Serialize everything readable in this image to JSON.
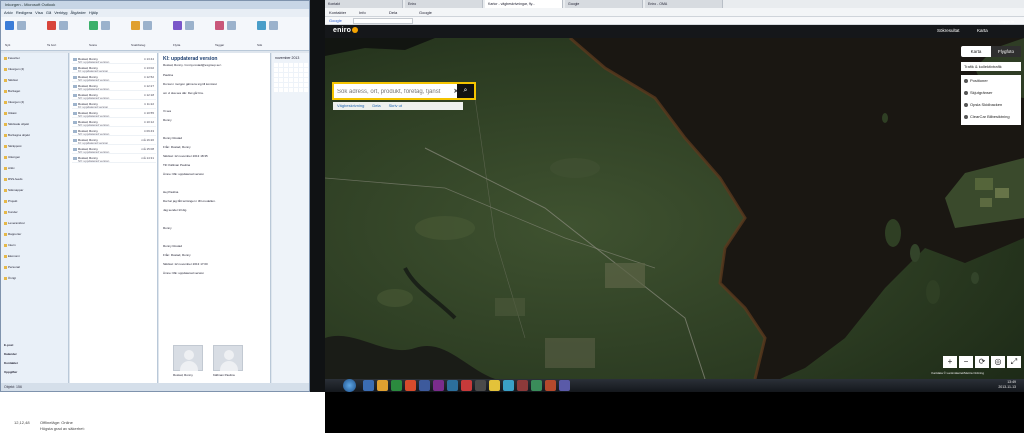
{
  "outlook": {
    "title": "Inkorgen - Microsoft Outlook",
    "menu": [
      "Arkiv",
      "Redigera",
      "Visa",
      "Gå",
      "Verktyg",
      "Åtgärder",
      "Hjälp"
    ],
    "ribbon_groups": [
      "Nytt",
      "Ta bort",
      "Svara",
      "Snabbsteg",
      "Flytta",
      "Taggar",
      "Sök"
    ],
    "folders": [
      "Favoriter",
      "Inkorgen (4)",
      "Skickat",
      "Borttaget",
      "Inkorgen (4)",
      "Utkast",
      "Skickade objekt",
      "Borttagna objekt",
      "Skräppost",
      "Utkorgen",
      "Arkiv",
      "RSS-feeds",
      "Sökmappar",
      "Projekt",
      "Kunder",
      "Leverantörer",
      "Rapporter",
      "Intern",
      "Ekonomi",
      "Personal",
      "Övrigt"
    ],
    "nav_buttons": [
      "E-post",
      "Kalender",
      "Kontakter",
      "Uppgifter"
    ],
    "message_list": [
      {
        "from": "Rostad, Ronny",
        "subject": "SV: uppdaterad version",
        "date": "ti 13:44"
      },
      {
        "from": "Rostad, Ronny",
        "subject": "KI: uppdaterad version",
        "date": "ti 13:02"
      },
      {
        "from": "Rostad, Ronny",
        "subject": "SV: uppdaterad version",
        "date": "ti 12:52"
      },
      {
        "from": "Rostad, Ronny",
        "subject": "SV: uppdaterad version",
        "date": "ti 12:27"
      },
      {
        "from": "Rostad, Ronny",
        "subject": "SV: uppdaterad version",
        "date": "ti 12:18"
      },
      {
        "from": "Rostad, Ronny",
        "subject": "KI: uppdaterad version",
        "date": "ti 11:22"
      },
      {
        "from": "Rostad, Ronny",
        "subject": "SV: uppdaterad version",
        "date": "ti 10:55"
      },
      {
        "from": "Rostad, Ronny",
        "subject": "SV: uppdaterad version",
        "date": "ti 10:12"
      },
      {
        "from": "Rostad, Ronny",
        "subject": "SV: uppdaterad version",
        "date": "ti 09:43"
      },
      {
        "from": "Rostad, Ronny",
        "subject": "KI: uppdaterad version",
        "date": "må 16:20"
      },
      {
        "from": "Rostad, Ronny",
        "subject": "SV: uppdaterad version",
        "date": "må 15:08"
      },
      {
        "from": "Rostad, Ronny",
        "subject": "SV: uppdaterad version",
        "date": "må 14:31"
      }
    ],
    "reading": {
      "subject": "KI: uppdaterad version",
      "sender": "Rostad, Ronny <ronny.rostad@exgroup.se>",
      "lines": [
        "Paulina",
        "Du kan i morgon gärna ta sig till kontoret",
        "om vi ska ses där. Det går bra.",
        "",
        "Vi ses",
        "Ronny",
        "",
        "Ronny Rostad",
        "Från: Rostad, Ronny",
        "Skickat: 12 november 2013 18:35",
        "Till: Källman Paulina",
        "Ämne: RE: uppdaterad version",
        "",
        "Hej Paulina",
        "Da har jag fått terrängen i 3D-modellen.",
        "Jag sender till dig.",
        "",
        "Ronny",
        "",
        "Ronny Rostad",
        "Från: Rostad, Ronny",
        "Skickat: 12 november 2013 17:00",
        "Ämne: RE: uppdaterad version"
      ],
      "contacts": [
        "Rostad, Ronny",
        "Källman Paulina"
      ]
    },
    "todo_month": "november 2013",
    "status": "Objekt: 156"
  },
  "left_bottom": {
    "line1": "12,12,48",
    "line2": "Offlineläge: Online",
    "line3": "Högsta grad av säkerhet:"
  },
  "browser": {
    "tabs": [
      {
        "label": "Kontakt",
        "active": false
      },
      {
        "label": "Eniro",
        "active": false
      },
      {
        "label": "Kartor - vägbeskrivningar, fly...",
        "active": true
      },
      {
        "label": "Google",
        "active": false
      },
      {
        "label": "Eniro - OMA",
        "active": false
      }
    ],
    "favorites": [
      "Kontakter",
      "Info",
      "Dela",
      "Google"
    ],
    "google_label": "Google"
  },
  "eniro": {
    "logo": "eniro",
    "header_links": [
      "Hitta",
      "Sök",
      "Kartor"
    ],
    "right_links": [
      "Sökresultat",
      "Karta"
    ],
    "login": "Logga in",
    "search_placeholder": "Sök adress, ort, produkt, företag, tjänst",
    "sub_actions": [
      "Vägbeskrivning",
      "Dela",
      "Skriv ut"
    ],
    "map_types": [
      "Karta",
      "Flygfoto",
      "Skikt"
    ],
    "map_type_selected": "Flygfoto",
    "traffic_label": "Trafik & kollektivtrafik",
    "layers": [
      "Positioner",
      "Skjutgränser",
      "Opsla Skidbacken",
      "ClearCar Bilbesiktning"
    ],
    "zoom_buttons": [
      "+",
      "−",
      "⟳",
      "◎",
      "⤢"
    ],
    "copyright": "Kartdata © Lantmäteriet/Metria Ordning"
  },
  "taskbar": {
    "time": "13:49",
    "date": "2013-11-13"
  }
}
